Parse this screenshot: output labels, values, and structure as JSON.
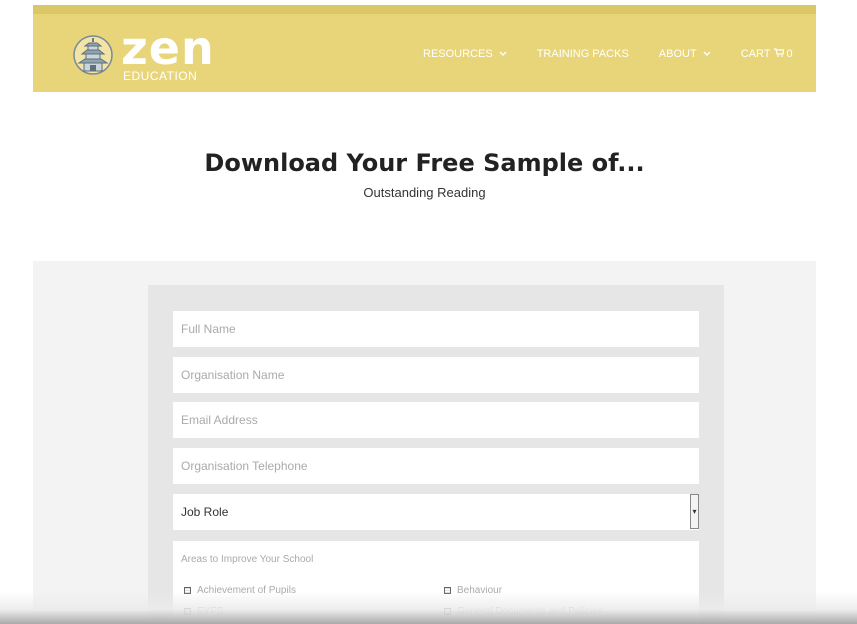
{
  "brand": {
    "name": "zen",
    "sub": "EDUCATION"
  },
  "nav": [
    {
      "label": "RESOURCES",
      "has_dropdown": true
    },
    {
      "label": "TRAINING PACKS",
      "has_dropdown": false
    },
    {
      "label": "ABOUT",
      "has_dropdown": true
    },
    {
      "label": "CART",
      "count": "0",
      "icon": "cart-icon"
    }
  ],
  "hero": {
    "title": "Download Your Free Sample of...",
    "subtitle": "Outstanding Reading"
  },
  "form": {
    "full_name_placeholder": "Full Name",
    "org_name_placeholder": "Organisation Name",
    "email_placeholder": "Email Address",
    "org_tel_placeholder": "Organisation Telephone",
    "job_role_value": "Job Role",
    "areas_title": "Areas to Improve Your School",
    "checkboxes": [
      "Achievement of Pupils",
      "Behaviour",
      "EYFS",
      "General Documents and Policies"
    ]
  },
  "colors": {
    "header": "#e8d57a",
    "header_strip": "#dcc767",
    "form_bg": "#e6e6e6",
    "page_bg": "#f3f3f3"
  }
}
